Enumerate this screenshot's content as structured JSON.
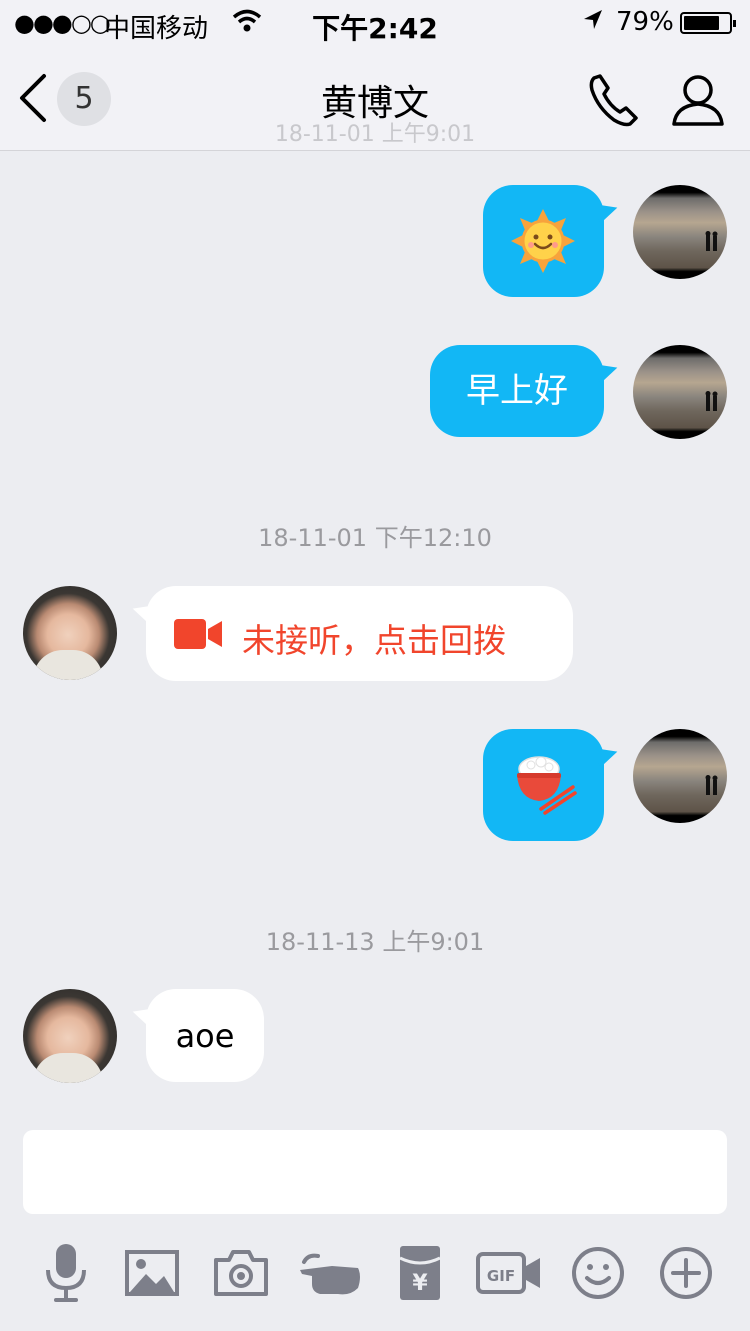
{
  "status_bar": {
    "signal_glyphs": "●●●○○",
    "carrier": "中国移动",
    "time": "下午2:42",
    "battery": "79%",
    "battery_level": 0.79
  },
  "nav": {
    "back_count": "5",
    "title": "黄博文",
    "ghost_timestamp": "18-11-01 上午9:01"
  },
  "messages": [
    {
      "from": "me",
      "type": "emoji",
      "emoji": "sun-face-emoji"
    },
    {
      "from": "me",
      "type": "text",
      "text": "早上好"
    },
    {
      "type": "timestamp",
      "text": "18-11-01 下午12:10"
    },
    {
      "from": "contact",
      "type": "missed-video-call",
      "text": "未接听，点击回拨"
    },
    {
      "from": "me",
      "type": "emoji",
      "emoji": "rice-bowl-emoji"
    },
    {
      "type": "timestamp",
      "text": "18-11-13 上午9:01"
    },
    {
      "from": "contact",
      "type": "text",
      "text": "aoe"
    }
  ],
  "input": {
    "value": "",
    "placeholder": ""
  },
  "toolbar": [
    "microphone-icon",
    "image-icon",
    "camera-icon",
    "poke-icon",
    "red-packet-icon",
    "gif-icon",
    "emoji-icon",
    "plus-icon"
  ],
  "colors": {
    "accent": "#12b7f5",
    "missed_call": "#f1452c",
    "background": "#ecedf1",
    "icon_gray": "#7d7f8a"
  }
}
